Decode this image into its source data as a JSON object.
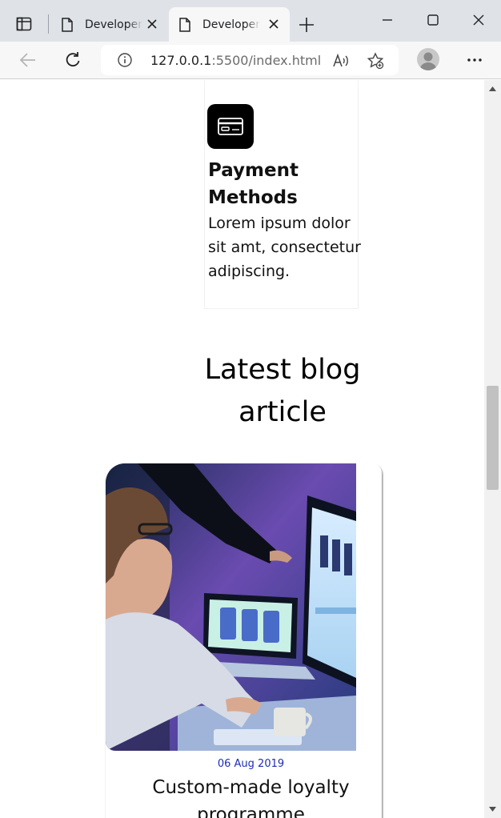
{
  "browser": {
    "tabs": [
      {
        "title": "Developer",
        "active": false
      },
      {
        "title": "Developer",
        "active": true
      }
    ],
    "address": {
      "host": "127.0.0.1",
      "rest": ":5500/index.html"
    },
    "icons": {
      "tab_actions": "tab-actions-icon",
      "page": "page-icon",
      "close": "close-icon",
      "new_tab": "plus-icon",
      "back": "back-arrow-icon",
      "refresh": "refresh-icon",
      "info": "info-icon",
      "read_aloud": "read-aloud-icon",
      "favorite": "star-add-icon",
      "profile": "profile-icon",
      "menu": "more-icon"
    }
  },
  "feature": {
    "icon": "credit-card-icon",
    "title": "Payment Methods",
    "description": "Lorem ipsum dolor sit amt, consectetur adipiscing."
  },
  "blog": {
    "section_title": "Latest blog article",
    "card": {
      "image": "developer-at-monitors-photo",
      "date": "06 Aug 2019",
      "title": "Custom-made loyalty programme"
    },
    "colors": {
      "date": "#1c2db8"
    }
  }
}
